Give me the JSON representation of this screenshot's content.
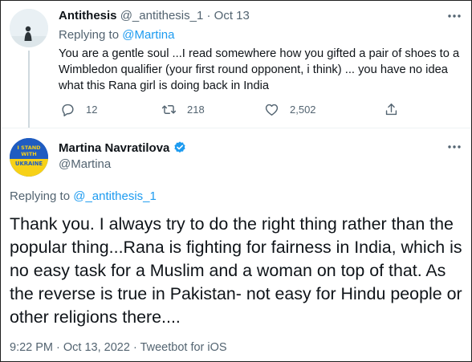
{
  "reply_tweet": {
    "author_name": "Antithesis",
    "author_handle": "@_antithesis_1",
    "separator": "·",
    "date": "Oct 13",
    "replying_prefix": "Replying to",
    "replying_handle": "@Martina",
    "text": "You are a gentle soul ...I read somewhere how you gifted a pair of shoes to a Wimbledon qualifier (your first round opponent, i think) ... you have no idea what this Rana girl is doing back in India",
    "actions": {
      "reply_count": "12",
      "retweet_count": "218",
      "like_count": "2,502"
    }
  },
  "main_tweet": {
    "author_name": "Martina Navratilova",
    "author_handle": "@Martina",
    "avatar_text": "I STAND WITH UKRAINE",
    "replying_prefix": "Replying to",
    "replying_handle": "@_antithesis_1",
    "text": "Thank you. I always try to do the right thing rather than the popular thing...Rana is fighting for fairness in India, which is no easy task for a Muslim and a woman on top of that. As the reverse is true in Pakistan- not easy for Hindu people or other religions there....",
    "time": "9:22 PM",
    "date": "Oct 13, 2022",
    "source": "Tweetbot for iOS",
    "separator": "·"
  },
  "icons": {
    "more": "more-icon",
    "reply": "reply-icon",
    "retweet": "retweet-icon",
    "like": "heart-icon",
    "share": "share-icon",
    "verified": "verified-badge-icon"
  },
  "colors": {
    "link": "#1d9bf0",
    "secondary_text": "#536471",
    "avatar_blue": "#1f5cc1",
    "avatar_yellow": "#f7d117"
  }
}
